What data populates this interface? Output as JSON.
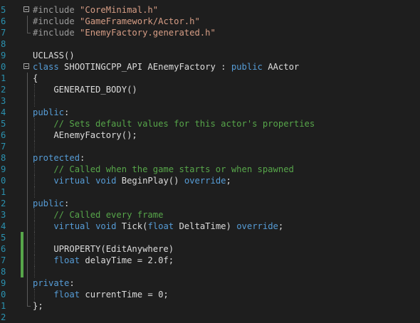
{
  "editor": {
    "lines": [
      {
        "num": "5",
        "segments": [
          {
            "t": "#include ",
            "c": "pp"
          },
          {
            "t": "\"CoreMinimal.h\"",
            "c": "str"
          }
        ],
        "fold": "start"
      },
      {
        "num": "6",
        "segments": [
          {
            "t": "#include ",
            "c": "pp"
          },
          {
            "t": "\"GameFramework/Actor.h\"",
            "c": "str"
          }
        ],
        "fold": "mid"
      },
      {
        "num": "7",
        "segments": [
          {
            "t": "#include ",
            "c": "pp"
          },
          {
            "t": "\"EnemyFactory.generated.h\"",
            "c": "str"
          }
        ],
        "fold": "end"
      },
      {
        "num": "8",
        "segments": []
      },
      {
        "num": "9",
        "segments": [
          {
            "t": "UCLASS()",
            "c": "cls"
          }
        ]
      },
      {
        "num": "0",
        "segments": [
          {
            "t": "class ",
            "c": "kw"
          },
          {
            "t": "SHOOTINGCPP_API AEnemyFactory : ",
            "c": "cls"
          },
          {
            "t": "public ",
            "c": "kw"
          },
          {
            "t": "AActor",
            "c": "cls"
          }
        ],
        "fold": "start"
      },
      {
        "num": "1",
        "segments": [
          {
            "t": "{",
            "c": "cls"
          }
        ],
        "fold": "mid"
      },
      {
        "num": "2",
        "segments": [
          {
            "t": "    GENERATED_BODY()",
            "c": "cls"
          }
        ],
        "fold": "mid",
        "indent": true
      },
      {
        "num": "3",
        "segments": [],
        "fold": "mid",
        "indent": true
      },
      {
        "num": "4",
        "segments": [
          {
            "t": "public",
            "c": "kw"
          },
          {
            "t": ":",
            "c": "cls"
          }
        ],
        "fold": "mid"
      },
      {
        "num": "5",
        "segments": [
          {
            "t": "    // Sets default values for this actor's properties",
            "c": "cmt"
          }
        ],
        "fold": "mid",
        "indent": true
      },
      {
        "num": "6",
        "segments": [
          {
            "t": "    AEnemyFactory();",
            "c": "cls"
          }
        ],
        "fold": "mid",
        "indent": true
      },
      {
        "num": "7",
        "segments": [],
        "fold": "mid",
        "indent": true
      },
      {
        "num": "8",
        "segments": [
          {
            "t": "protected",
            "c": "kw"
          },
          {
            "t": ":",
            "c": "cls"
          }
        ],
        "fold": "mid"
      },
      {
        "num": "9",
        "segments": [
          {
            "t": "    // Called when the game starts or when spawned",
            "c": "cmt"
          }
        ],
        "fold": "mid",
        "indent": true
      },
      {
        "num": "0",
        "segments": [
          {
            "t": "    virtual ",
            "c": "kw"
          },
          {
            "t": "void ",
            "c": "kw"
          },
          {
            "t": "BeginPlay() ",
            "c": "cls"
          },
          {
            "t": "override",
            "c": "kw"
          },
          {
            "t": ";",
            "c": "cls"
          }
        ],
        "fold": "mid",
        "indent": true
      },
      {
        "num": "1",
        "segments": [],
        "fold": "mid",
        "indent": true
      },
      {
        "num": "2",
        "segments": [
          {
            "t": "public",
            "c": "kw"
          },
          {
            "t": ":",
            "c": "cls"
          }
        ],
        "fold": "mid"
      },
      {
        "num": "3",
        "segments": [
          {
            "t": "    // Called every frame",
            "c": "cmt"
          }
        ],
        "fold": "mid",
        "indent": true
      },
      {
        "num": "4",
        "segments": [
          {
            "t": "    virtual ",
            "c": "kw"
          },
          {
            "t": "void ",
            "c": "kw"
          },
          {
            "t": "Tick(",
            "c": "cls"
          },
          {
            "t": "float ",
            "c": "kw"
          },
          {
            "t": "DeltaTime) ",
            "c": "cls"
          },
          {
            "t": "override",
            "c": "kw"
          },
          {
            "t": ";",
            "c": "cls"
          }
        ],
        "fold": "mid",
        "indent": true
      },
      {
        "num": "5",
        "segments": [],
        "fold": "mid",
        "indent": true,
        "changed": true
      },
      {
        "num": "6",
        "segments": [
          {
            "t": "    UPROPERTY(EditAnywhere)",
            "c": "cls"
          }
        ],
        "fold": "mid",
        "indent": true,
        "changed": true
      },
      {
        "num": "7",
        "segments": [
          {
            "t": "    float ",
            "c": "kw"
          },
          {
            "t": "delayTime = 2.0f;",
            "c": "cls"
          }
        ],
        "fold": "mid",
        "indent": true,
        "changed": true
      },
      {
        "num": "8",
        "segments": [],
        "fold": "mid",
        "indent": true,
        "changed": true
      },
      {
        "num": "9",
        "segments": [
          {
            "t": "private",
            "c": "kw"
          },
          {
            "t": ":",
            "c": "cls"
          }
        ],
        "fold": "mid"
      },
      {
        "num": "0",
        "segments": [
          {
            "t": "    float ",
            "c": "kw"
          },
          {
            "t": "currentTime = 0;",
            "c": "cls"
          }
        ],
        "fold": "mid",
        "indent": true
      },
      {
        "num": "1",
        "segments": [
          {
            "t": "};",
            "c": "cls"
          }
        ],
        "fold": "end"
      },
      {
        "num": "2",
        "segments": []
      }
    ]
  }
}
